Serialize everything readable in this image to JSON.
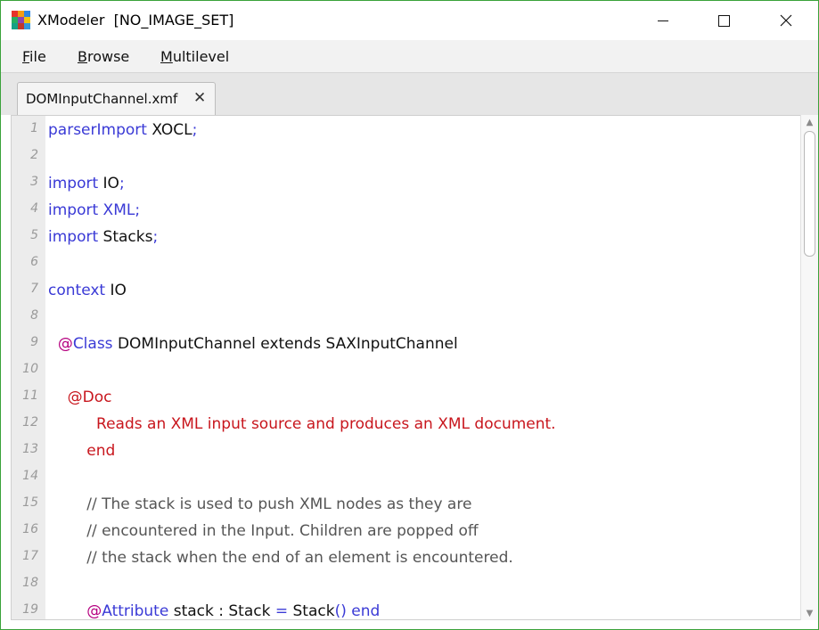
{
  "window": {
    "app_name": "XModeler",
    "image_status": "[NO_IMAGE_SET]",
    "controls": {
      "minimize": "minimize",
      "maximize": "maximize",
      "close": "close"
    }
  },
  "app_icon_colors": [
    "#e8332a",
    "#f39c12",
    "#2e86de",
    "#27ae60",
    "#8e44ad",
    "#f1c40f",
    "#16a085",
    "#c0392b",
    "#3498db"
  ],
  "menu": [
    {
      "label": "File",
      "mnemonic": "F",
      "rest": "ile"
    },
    {
      "label": "Browse",
      "mnemonic": "B",
      "rest": "rowse"
    },
    {
      "label": "Multilevel",
      "mnemonic": "M",
      "rest": "ultilevel"
    }
  ],
  "tab": {
    "label": "DOMInputChannel.xmf",
    "close_glyph": "✕"
  },
  "code_lines": [
    {
      "n": "1",
      "indent": "",
      "tokens": [
        {
          "t": "parserImport",
          "c": "kw"
        },
        {
          "t": " XOCL",
          "c": "pl"
        },
        {
          "t": ";",
          "c": "kw"
        }
      ]
    },
    {
      "n": "2",
      "indent": "",
      "tokens": []
    },
    {
      "n": "3",
      "indent": "",
      "tokens": [
        {
          "t": "import",
          "c": "kw"
        },
        {
          "t": " IO",
          "c": "pl"
        },
        {
          "t": ";",
          "c": "kw"
        }
      ]
    },
    {
      "n": "4",
      "indent": "",
      "tokens": [
        {
          "t": "import",
          "c": "kw"
        },
        {
          "t": " XML",
          "c": "kw"
        },
        {
          "t": ";",
          "c": "kw"
        }
      ]
    },
    {
      "n": "5",
      "indent": "",
      "tokens": [
        {
          "t": "import",
          "c": "kw"
        },
        {
          "t": " Stacks",
          "c": "pl"
        },
        {
          "t": ";",
          "c": "kw"
        }
      ]
    },
    {
      "n": "6",
      "indent": "",
      "tokens": []
    },
    {
      "n": "7",
      "indent": "",
      "tokens": [
        {
          "t": "context",
          "c": "kw"
        },
        {
          "t": " IO",
          "c": "pl"
        }
      ]
    },
    {
      "n": "8",
      "indent": "",
      "tokens": []
    },
    {
      "n": "9",
      "indent": "  ",
      "tokens": [
        {
          "t": "@",
          "c": "at"
        },
        {
          "t": "Class",
          "c": "kw"
        },
        {
          "t": " DOMInputChannel extends SAXInputChannel",
          "c": "pl"
        }
      ]
    },
    {
      "n": "10",
      "indent": "",
      "tokens": []
    },
    {
      "n": "11",
      "indent": "    ",
      "tokens": [
        {
          "t": "@Doc",
          "c": "doc"
        }
      ]
    },
    {
      "n": "12",
      "indent": "          ",
      "tokens": [
        {
          "t": "Reads an XML input source and produces an XML document.",
          "c": "doc"
        }
      ]
    },
    {
      "n": "13",
      "indent": "        ",
      "tokens": [
        {
          "t": "end",
          "c": "doc"
        }
      ]
    },
    {
      "n": "14",
      "indent": "",
      "tokens": []
    },
    {
      "n": "15",
      "indent": "        ",
      "tokens": [
        {
          "t": "// The stack is used to push XML nodes as they are",
          "c": "cm"
        }
      ]
    },
    {
      "n": "16",
      "indent": "        ",
      "tokens": [
        {
          "t": "// encountered in the Input. Children are popped off",
          "c": "cm"
        }
      ]
    },
    {
      "n": "17",
      "indent": "        ",
      "tokens": [
        {
          "t": "// the stack when the end of an element is encountered.",
          "c": "cm"
        }
      ]
    },
    {
      "n": "18",
      "indent": "",
      "tokens": []
    },
    {
      "n": "19",
      "indent": "        ",
      "tokens": [
        {
          "t": "@",
          "c": "at"
        },
        {
          "t": "Attribute",
          "c": "kw"
        },
        {
          "t": " stack : Stack ",
          "c": "pl"
        },
        {
          "t": "=",
          "c": "kw"
        },
        {
          "t": " Stack",
          "c": "pl"
        },
        {
          "t": "() end",
          "c": "kw"
        }
      ]
    }
  ],
  "scrollbar": {
    "up_icon": "▲",
    "down_icon": "▼"
  }
}
